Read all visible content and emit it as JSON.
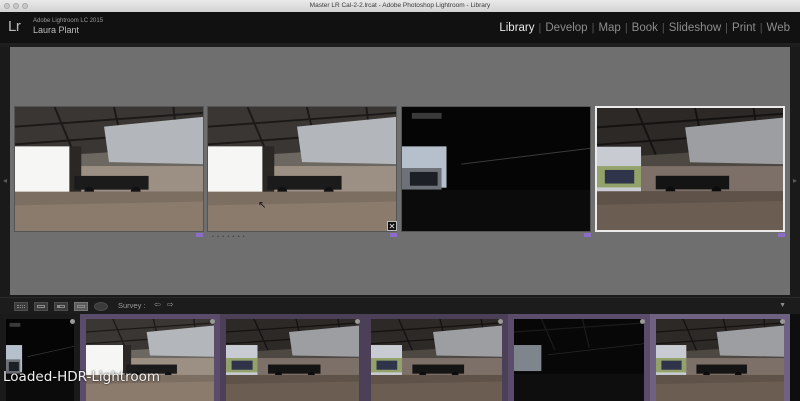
{
  "window": {
    "title": "Master LR Cal-2-2.lrcat - Adobe Photoshop Lightroom - Library"
  },
  "identity": {
    "logo": "Lr",
    "version": "Adobe Lightroom LC 2015",
    "user": "Laura Plant"
  },
  "modules": [
    {
      "label": "Library",
      "active": true
    },
    {
      "label": "Develop"
    },
    {
      "label": "Map"
    },
    {
      "label": "Book"
    },
    {
      "label": "Slideshow"
    },
    {
      "label": "Print"
    },
    {
      "label": "Web"
    }
  ],
  "module_separator": "|",
  "grid": {
    "photos": [
      {
        "name": "barn-photo-1",
        "exposure": "bright"
      },
      {
        "name": "barn-photo-2",
        "exposure": "bright"
      },
      {
        "name": "barn-photo-3",
        "exposure": "dark",
        "rejected": true
      },
      {
        "name": "barn-photo-4",
        "exposure": "normal",
        "selected": true
      }
    ],
    "reject_glyph": "✕",
    "meta_dots": "• • • • • • •",
    "cursor_glyph": "↖",
    "left_arrow": "◂",
    "right_arrow": "▸"
  },
  "toolbar": {
    "view_label": "Survey :",
    "prev_arrow": "⇦",
    "next_arrow": "⇨",
    "dropdown_arrow": "▼",
    "view_icons": [
      "grid-view-icon",
      "loupe-view-icon",
      "compare-view-icon",
      "survey-view-icon",
      "people-view-icon"
    ]
  },
  "filmstrip": {
    "cells": [
      {
        "exposure": "dark",
        "highlighted": false
      },
      {
        "exposure": "bright",
        "highlighted": true
      },
      {
        "exposure": "dark",
        "highlighted": true
      },
      {
        "exposure": "dark",
        "highlighted": true
      },
      {
        "exposure": "very-dark",
        "highlighted": true
      },
      {
        "exposure": "normal",
        "highlighted": true,
        "selected": true
      }
    ]
  },
  "overlay": {
    "caption": "Loaded-HDR-Lightroom"
  },
  "colors": {
    "accent_purple": "#8b6cc7",
    "grid_background": "#6f6f6f",
    "active_module": "#e8e8e8"
  }
}
